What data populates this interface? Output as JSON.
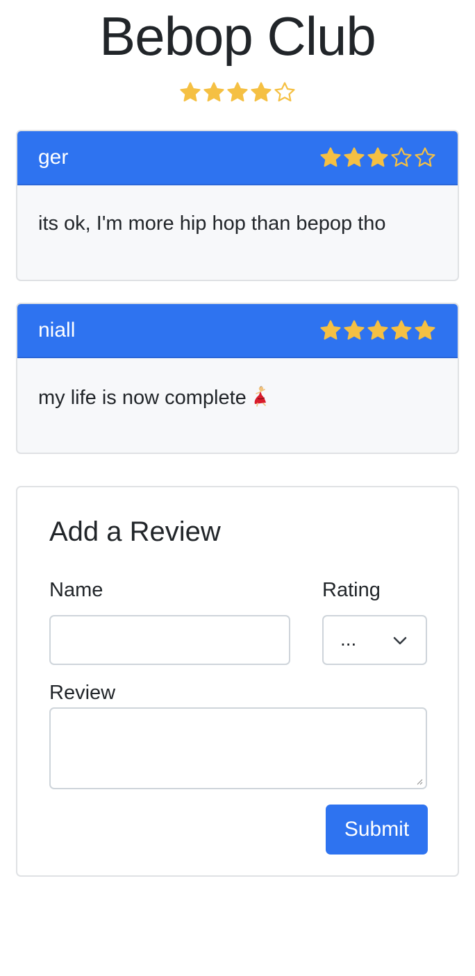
{
  "header": {
    "title": "Bebop Club",
    "overall_rating": 4,
    "max_rating": 5
  },
  "reviews": [
    {
      "name": "ger",
      "rating": 3,
      "text": "its ok, I'm more hip hop than bepop tho"
    },
    {
      "name": "niall",
      "rating": 5,
      "text": "my life is now complete",
      "emoji_icon": "dancer-icon"
    }
  ],
  "form": {
    "title": "Add a Review",
    "name_label": "Name",
    "name_value": "",
    "rating_label": "Rating",
    "rating_value": "...",
    "review_label": "Review",
    "review_value": "",
    "submit_label": "Submit"
  },
  "colors": {
    "primary": "#2e73f0",
    "star": "#f5c043",
    "card_bg": "#f7f8fa",
    "text": "#212529"
  }
}
